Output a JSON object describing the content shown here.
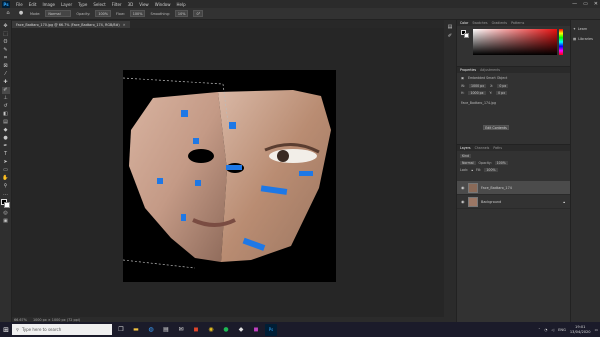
{
  "app": {
    "logo": "Ps",
    "menu": [
      "File",
      "Edit",
      "Image",
      "Layer",
      "Type",
      "Select",
      "Filter",
      "3D",
      "View",
      "Window",
      "Help"
    ],
    "window_controls": [
      "—",
      "▭",
      "✕"
    ]
  },
  "options_bar": {
    "mode_label": "Mode:",
    "mode_value": "Normal",
    "opacity_label": "Opacity:",
    "opacity_value": "100%",
    "flow_label": "Flow:",
    "flow_value": "100%",
    "smoothing_label": "Smoothing:",
    "smoothing_value": "10%",
    "angle_value": "0°"
  },
  "document_tab": {
    "title": "Face_Badtaro_170.jpg @ 66.7% (Face_Badtaro_174, RGB/8#)",
    "close": "✕"
  },
  "status_bar": {
    "zoom": "66.67%",
    "doc_info": "1000 px × 1000 px (72 ppi)"
  },
  "color_panel": {
    "tabs": [
      "Color",
      "Swatches",
      "Gradients",
      "Patterns"
    ],
    "accent_hex": "#e81010"
  },
  "properties_panel": {
    "tabs": [
      "Properties",
      "Adjustments"
    ],
    "kind": "Embedded Smart Object",
    "w_label": "W:",
    "w_value": "1000 px",
    "h_label": "H:",
    "h_value": "1000 px",
    "x_label": "X:",
    "x_value": "0 px",
    "y_label": "Y:",
    "y_value": "0 px",
    "file_name": "Face_Badtaro_174.jpg",
    "button": "Edit Contents"
  },
  "layers_panel": {
    "tabs": [
      "Layers",
      "Channels",
      "Paths"
    ],
    "filter_label": "Kind",
    "blend_mode": "Normal",
    "opacity_label": "Opacity:",
    "opacity_value": "100%",
    "lock_label": "Lock:",
    "fill_label": "Fill:",
    "fill_value": "100%",
    "layers": [
      {
        "name": "Face_Badtaro_174",
        "selected": true
      },
      {
        "name": "Background",
        "selected": false
      }
    ]
  },
  "side_strip": {
    "items": [
      "Learn",
      "Libraries"
    ]
  },
  "taskbar": {
    "search_placeholder": "Type here to search",
    "tray_lang": "ENG",
    "time": "19:01",
    "date": "13/04/2020"
  }
}
